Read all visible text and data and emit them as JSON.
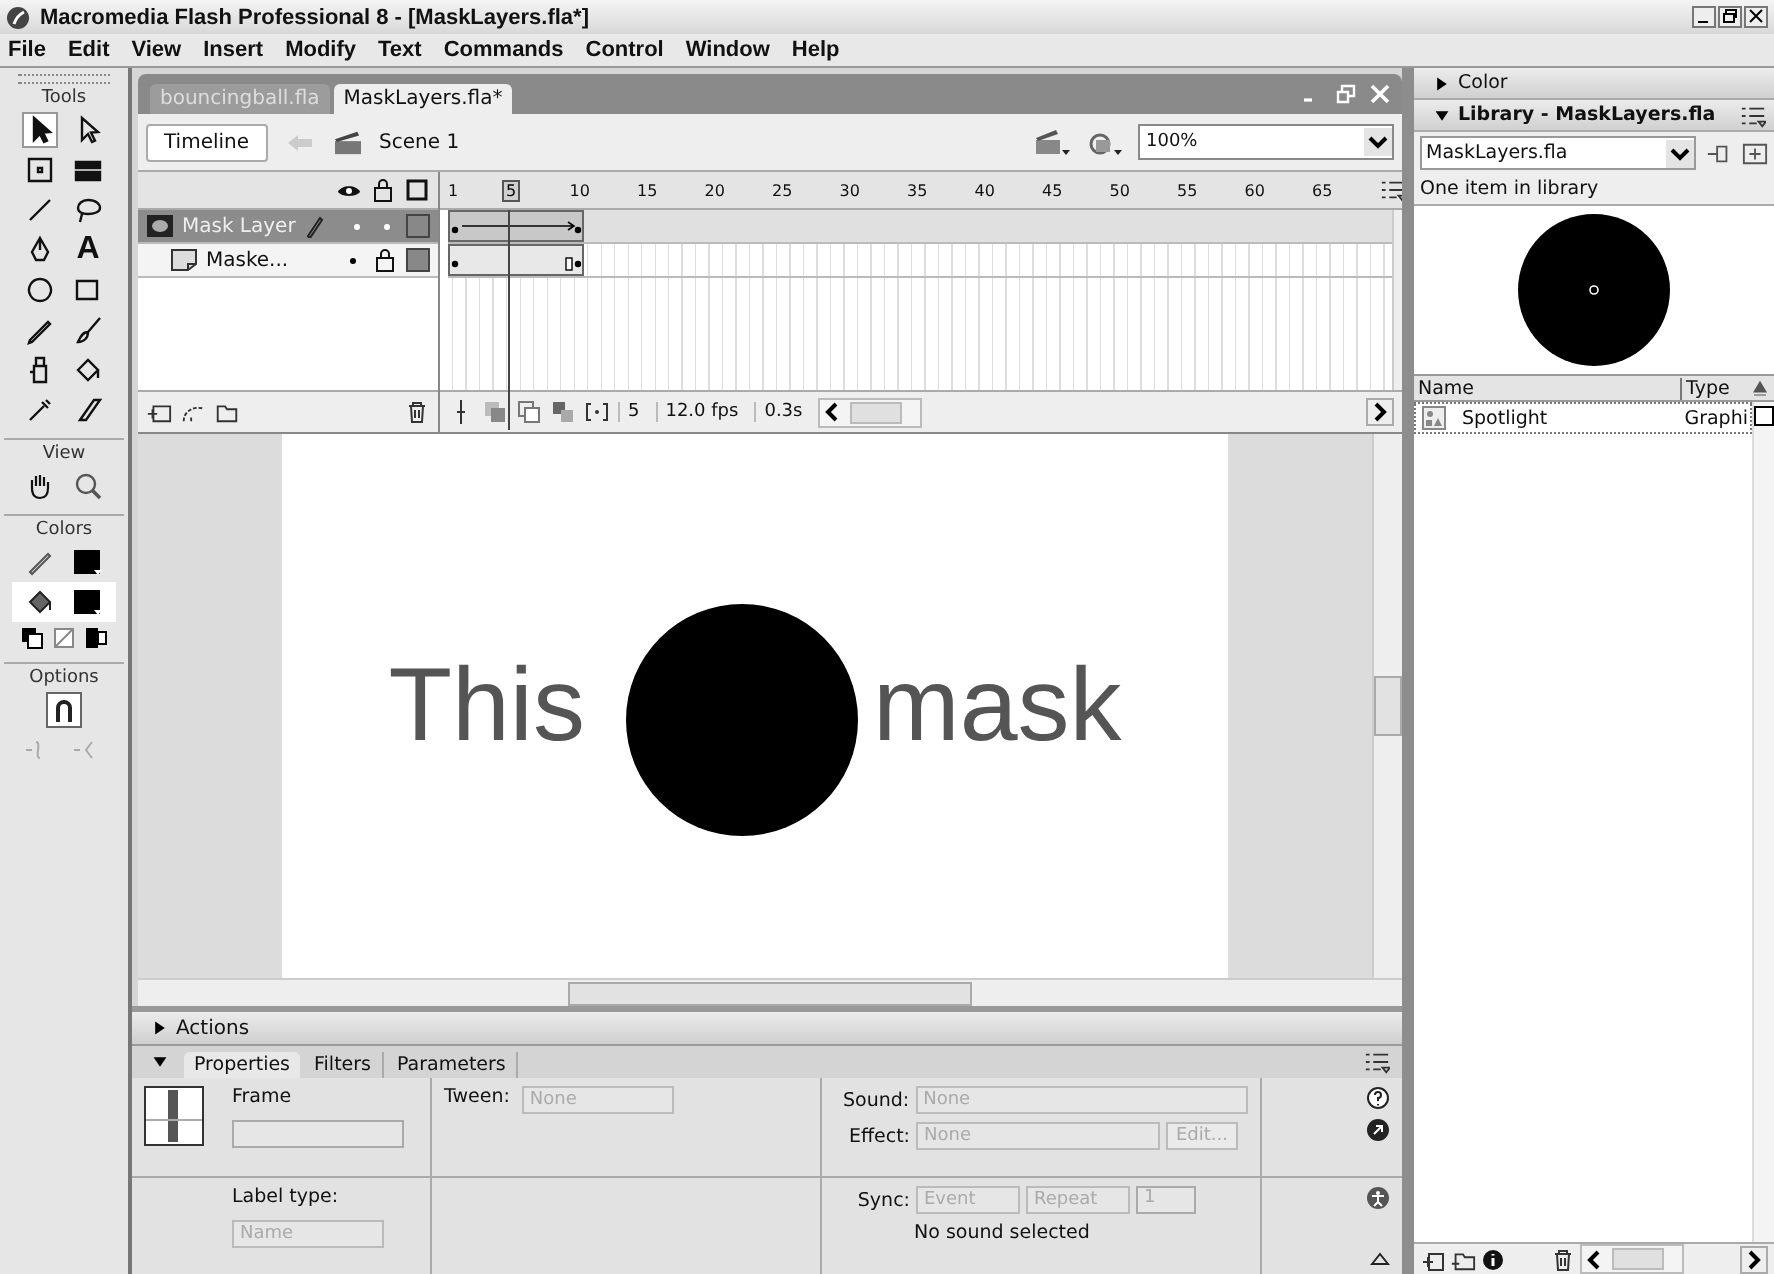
{
  "window": {
    "title": "Macromedia Flash Professional 8 - [MaskLayers.fla*]"
  },
  "menu": [
    "File",
    "Edit",
    "View",
    "Insert",
    "Modify",
    "Text",
    "Commands",
    "Control",
    "Window",
    "Help"
  ],
  "tools": {
    "title": "Tools",
    "text_tool_glyph": "A",
    "view_label": "View",
    "colors_label": "Colors",
    "options_label": "Options"
  },
  "document_tabs": [
    {
      "label": "bouncingball.fla",
      "selected": false
    },
    {
      "label": "MaskLayers.fla*",
      "selected": true
    }
  ],
  "edit_bar": {
    "timeline_button": "Timeline",
    "scene": "Scene 1",
    "zoom": "100%"
  },
  "timeline": {
    "frame_numbers": [
      "1",
      "5",
      "10",
      "15",
      "20",
      "25",
      "30",
      "35",
      "40",
      "45",
      "50",
      "55",
      "60",
      "65"
    ],
    "layers": [
      {
        "name": "Mask Layer",
        "selected": true,
        "kind": "mask"
      },
      {
        "name": "Maske...",
        "selected": false,
        "kind": "masked"
      }
    ],
    "current_frame": "5",
    "frame_rate": "12.0 fps",
    "elapsed": "0.3s"
  },
  "stage": {
    "texts": [
      "This",
      "mask"
    ]
  },
  "actions_panel": {
    "title": "Actions",
    "expanded": false
  },
  "properties": {
    "tabs": [
      {
        "label": "Properties",
        "selected": true
      },
      {
        "label": "Filters",
        "selected": false
      },
      {
        "label": "Parameters",
        "selected": false
      }
    ],
    "expanded": true,
    "frame_label": "Frame",
    "tween_label": "Tween:",
    "tween_value": "None",
    "sound_label": "Sound:",
    "sound_value": "None",
    "effect_label": "Effect:",
    "effect_value": "None",
    "edit_button": "Edit...",
    "label_type_label": "Label type:",
    "label_type_value": "Name",
    "sync_label": "Sync:",
    "sync_value": "Event",
    "repeat_value": "Repeat",
    "repeat_count": "1",
    "sound_status": "No sound selected"
  },
  "color_panel": {
    "title": "Color",
    "expanded": false
  },
  "library": {
    "title": "Library - MaskLayers.fla",
    "expanded": true,
    "document": "MaskLayers.fla",
    "count_text": "One item in library",
    "columns": [
      "Name",
      "Type"
    ],
    "items": [
      {
        "name": "Spotlight",
        "type": "Graphi",
        "selected": false
      }
    ]
  }
}
